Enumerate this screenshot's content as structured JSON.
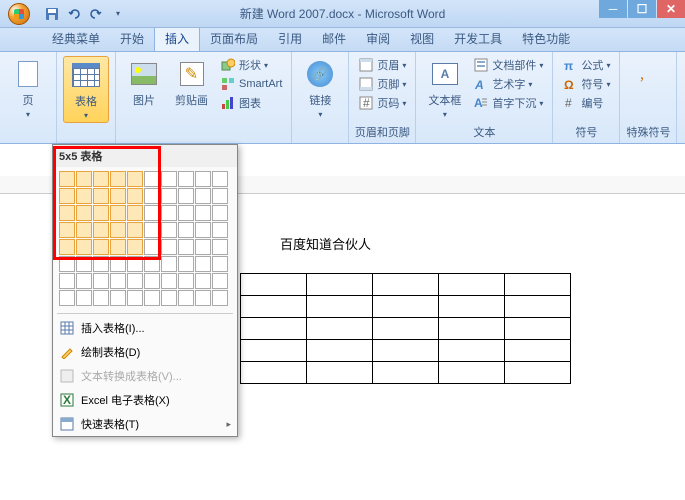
{
  "title": "新建 Word 2007.docx - Microsoft Word",
  "tabs": {
    "classic": "经典菜单",
    "home": "开始",
    "insert": "插入",
    "layout": "页面布局",
    "reference": "引用",
    "mail": "邮件",
    "review": "审阅",
    "view": "视图",
    "dev": "开发工具",
    "special": "特色功能"
  },
  "ribbon": {
    "page": {
      "label": "页"
    },
    "table": {
      "btn": "表格",
      "group": ""
    },
    "illus": {
      "pic": "图片",
      "clip": "剪贴画",
      "shapes": "形状",
      "smartart": "SmartArt",
      "chart": "图表"
    },
    "link": {
      "btn": "链接"
    },
    "headerfooter": {
      "header": "页眉",
      "footer": "页脚",
      "pagenum": "页码",
      "group": "页眉和页脚"
    },
    "text": {
      "textbox": "文本框",
      "parts": "文档部件",
      "wordart": "艺术字",
      "dropcap": "首字下沉",
      "group": "文本"
    },
    "symbol": {
      "formula": "公式",
      "symbol": "符号",
      "number": "编号",
      "group": "符号"
    },
    "special": {
      "group": "特殊符号"
    }
  },
  "dropdown": {
    "header": "5x5 表格",
    "insert": "插入表格(I)...",
    "draw": "绘制表格(D)",
    "convert": "文本转换成表格(V)...",
    "excel": "Excel 电子表格(X)",
    "quick": "快速表格(T)"
  },
  "document": {
    "text": "百度知道合伙人"
  }
}
